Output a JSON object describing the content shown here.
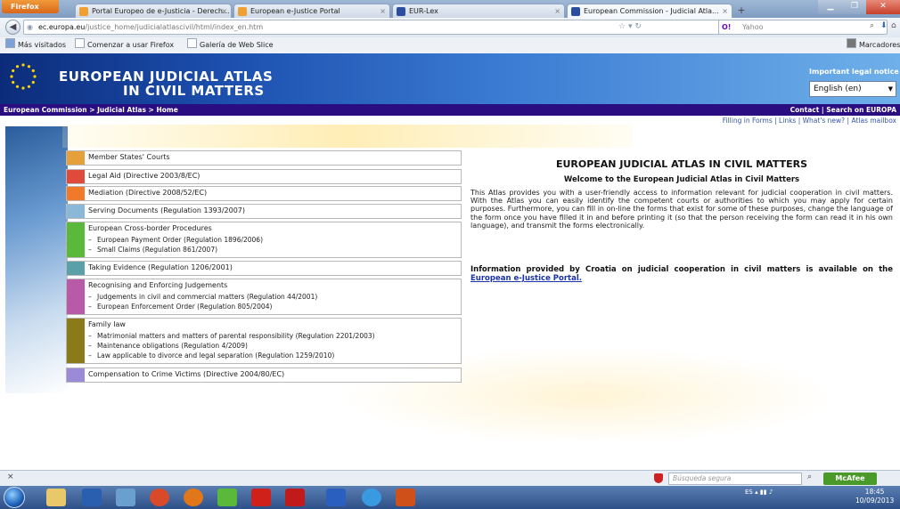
{
  "browser": {
    "app_button": "Firefox",
    "tabs": [
      {
        "label": "Portal Europeo de e-Justicia - Derech...",
        "icon_color": "#f0a030"
      },
      {
        "label": "European e-Justice Portal",
        "icon_color": "#f0a030"
      },
      {
        "label": "EUR-Lex",
        "icon_color": "#2a4fa0"
      },
      {
        "label": "European Commission - Judicial Atla...",
        "icon_color": "#2a4fa0"
      }
    ],
    "new_tab": "+",
    "tab_close": "×",
    "url_domain": "ec.europa.eu",
    "url_path": "/justice_home/judicialatlascivil/html/index_en.htm",
    "search_engine": "Yahoo",
    "search_prefix": "O!",
    "bookmarks": [
      "Más visitados",
      "Comenzar a usar Firefox",
      "Galería de Web Slice"
    ],
    "bookmarks_button": "Marcadores"
  },
  "header": {
    "title_line1": "EUROPEAN JUDICIAL ATLAS",
    "title_line2": "IN CIVIL MATTERS",
    "legal_notice": "Important legal notice",
    "language": "English (en)"
  },
  "crumb": {
    "left": "European Commission > Judicial Atlas > Home",
    "right": "Contact | Search on EUROPA"
  },
  "top_links": "Filling in Forms | Links | What's new? | Atlas mailbox",
  "menu": [
    {
      "title": "Member States' Courts",
      "color": "#e6a03a",
      "subs": []
    },
    {
      "title": "Legal Aid (Directive 2003/8/EC)",
      "color": "#e04a3a",
      "subs": []
    },
    {
      "title": "Mediation (Directive 2008/52/EC)",
      "color": "#f07a2a",
      "subs": []
    },
    {
      "title": "Serving Documents (Regulation 1393/2007)",
      "color": "#8ab8d8",
      "subs": []
    },
    {
      "title": "European Cross-border Procedures",
      "color": "#5ab83a",
      "subs": [
        "European Payment Order (Regulation 1896/2006)",
        "Small Claims (Regulation 861/2007)"
      ]
    },
    {
      "title": "Taking Evidence (Regulation 1206/2001)",
      "color": "#5aa0a8",
      "subs": []
    },
    {
      "title": "Recognising and Enforcing Judgements",
      "color": "#b85aa8",
      "subs": [
        "Judgements in civil and commercial matters (Regulation 44/2001)",
        "European Enforcement Order (Regulation 805/2004)"
      ]
    },
    {
      "title": "Family law",
      "color": "#8a7a1a",
      "subs": [
        "Matrimonial matters and matters of parental responsibility (Regulation 2201/2003)",
        "Maintenance obligations (Regulation 4/2009)",
        "Law applicable to divorce and legal separation (Regulation 1259/2010)"
      ]
    },
    {
      "title": "Compensation to Crime Victims (Directive 2004/80/EC)",
      "color": "#9a8ad8",
      "subs": []
    }
  ],
  "main": {
    "title": "EUROPEAN JUDICIAL ATLAS IN CIVIL MATTERS",
    "subtitle": "Welcome to the European Judicial Atlas in Civil Matters",
    "paragraph": "This Atlas provides you with a user-friendly access to information relevant for judicial cooperation in civil matters. With the Atlas you can easily identify the competent courts or authorities to which you may apply for certain purposes. Furthermore, you can fill in on-line the forms that exist for some of these purposes, change the language of the form once you have filled it in and before printing it (so that the person receiving the form can read it in his own language), and transmit the forms electronically.",
    "info_text": "Information provided by Croatia on judicial cooperation in civil matters is available on the",
    "info_link": "European e-Justice Portal."
  },
  "addon_bar": {
    "close": "×",
    "safe_search_placeholder": "Búsqueda segura",
    "mcafee": "McAfee"
  },
  "taskbar": {
    "apps": [
      {
        "name": "explorer-icon",
        "color": "#e8c86a"
      },
      {
        "name": "media-icon",
        "color": "#2a5fb0"
      },
      {
        "name": "paint-icon",
        "color": "#6aa0d0"
      },
      {
        "name": "chrome-icon",
        "color": "#d84a2a"
      },
      {
        "name": "firefox-icon",
        "color": "#e0781a"
      },
      {
        "name": "checkmark-app-icon",
        "color": "#5ab83a"
      },
      {
        "name": "opera-icon",
        "color": "#d0201a"
      },
      {
        "name": "pdf-icon",
        "color": "#c01a1a"
      },
      {
        "name": "word-icon",
        "color": "#2a5fc0"
      },
      {
        "name": "ie-icon",
        "color": "#3a9ae0"
      },
      {
        "name": "powerpoint-icon",
        "color": "#d0501a"
      }
    ],
    "lang": "ES",
    "time": "18:45",
    "date": "10/09/2013"
  }
}
